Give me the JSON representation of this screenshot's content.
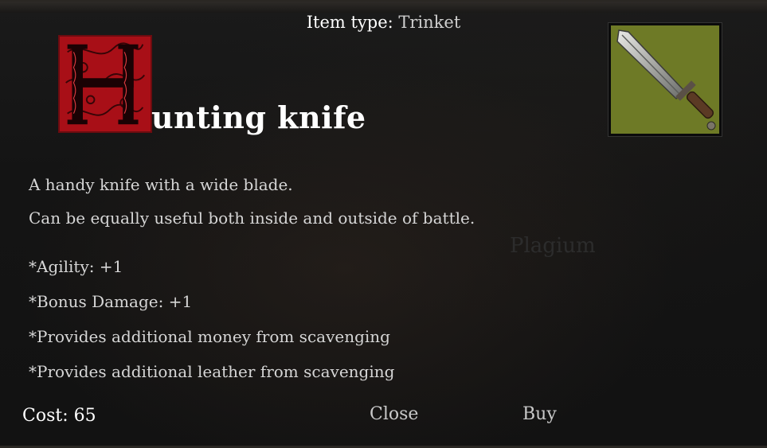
{
  "header": {
    "item_type_label": "Item type:",
    "item_type_value": "Trinket"
  },
  "item": {
    "initial_letter": "H",
    "title_rest": "unting knife",
    "portrait_icon": "knife-icon",
    "portrait_bg": "#6e7a26",
    "initial_bg": "#b3121a",
    "description": [
      "A handy knife with a wide blade.",
      "Can be equally useful both inside and outside of battle."
    ],
    "stats": [
      "*Agility: +1",
      "*Bonus Damage: +1",
      "*Provides additional money from scavenging",
      "*Provides additional leather from scavenging"
    ]
  },
  "watermark": "Plagium",
  "footer": {
    "cost": "Cost: 65",
    "close_label": "Close",
    "buy_label": "Buy"
  }
}
